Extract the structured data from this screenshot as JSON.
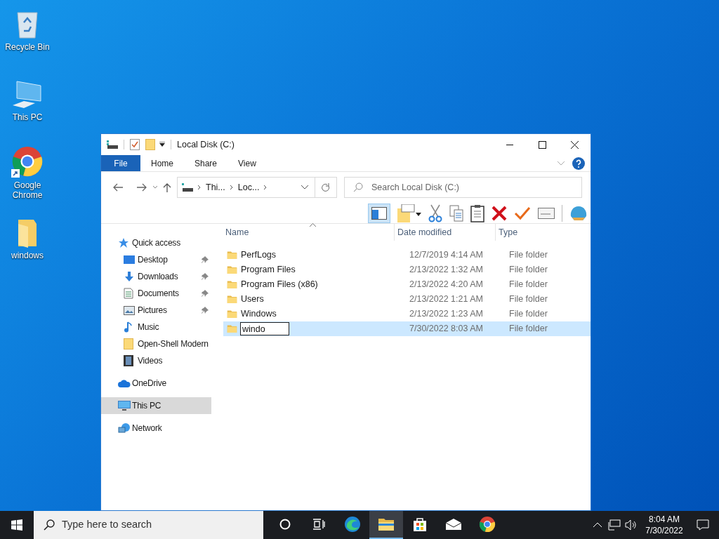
{
  "desktop_icons": [
    {
      "label": "Recycle Bin",
      "kind": "recycle"
    },
    {
      "label": "This PC",
      "kind": "pc"
    },
    {
      "label": "Google Chrome",
      "kind": "chrome"
    },
    {
      "label": "windows",
      "kind": "folder"
    }
  ],
  "window": {
    "title": "Local Disk (C:)",
    "ribbon_tabs": [
      {
        "label": "File",
        "selected": true
      },
      {
        "label": "Home",
        "selected": false
      },
      {
        "label": "Share",
        "selected": false
      },
      {
        "label": "View",
        "selected": false
      }
    ],
    "breadcrumbs": [
      "Thi...",
      "Loc..."
    ],
    "search": {
      "placeholder": "Search Local Disk (C:)"
    },
    "nav": [
      {
        "label": "Quick access",
        "kind": "star",
        "selected": false,
        "children": [
          {
            "label": "Desktop",
            "kind": "desktop",
            "pinned": true
          },
          {
            "label": "Downloads",
            "kind": "download",
            "pinned": true
          },
          {
            "label": "Documents",
            "kind": "document",
            "pinned": true
          },
          {
            "label": "Pictures",
            "kind": "pictures",
            "pinned": true
          },
          {
            "label": "Music",
            "kind": "music",
            "pinned": false
          },
          {
            "label": "Open-Shell Modern",
            "kind": "folder",
            "pinned": false
          },
          {
            "label": "Videos",
            "kind": "video",
            "pinned": false
          }
        ]
      },
      {
        "label": "OneDrive",
        "kind": "cloud",
        "selected": false
      },
      {
        "label": "This PC",
        "kind": "pc",
        "selected": true
      },
      {
        "label": "Network",
        "kind": "network",
        "selected": false
      }
    ],
    "columns": [
      "Name",
      "Date modified",
      "Type"
    ],
    "rows": [
      {
        "name": "PerfLogs",
        "date": "12/7/2019 4:14 AM",
        "type": "File folder",
        "selected": false,
        "editing": false
      },
      {
        "name": "Program Files",
        "date": "2/13/2022 1:32 AM",
        "type": "File folder",
        "selected": false,
        "editing": false
      },
      {
        "name": "Program Files (x86)",
        "date": "2/13/2022 4:20 AM",
        "type": "File folder",
        "selected": false,
        "editing": false
      },
      {
        "name": "Users",
        "date": "2/13/2022 1:21 AM",
        "type": "File folder",
        "selected": false,
        "editing": false
      },
      {
        "name": "Windows",
        "date": "2/13/2022 1:23 AM",
        "type": "File folder",
        "selected": false,
        "editing": false
      },
      {
        "name": "windo",
        "date": "7/30/2022 8:03 AM",
        "type": "File folder",
        "selected": true,
        "editing": true
      }
    ]
  },
  "taskbar": {
    "search": {
      "placeholder": "Type here to search"
    },
    "apps": [
      {
        "kind": "cortana",
        "active": false
      },
      {
        "kind": "taskview",
        "active": false
      },
      {
        "kind": "edge",
        "active": false
      },
      {
        "kind": "explorer",
        "active": true
      },
      {
        "kind": "store",
        "active": false
      },
      {
        "kind": "mail",
        "active": false
      },
      {
        "kind": "chrome",
        "active": false
      }
    ],
    "time": "8:04 AM",
    "date": "7/30/2022"
  }
}
